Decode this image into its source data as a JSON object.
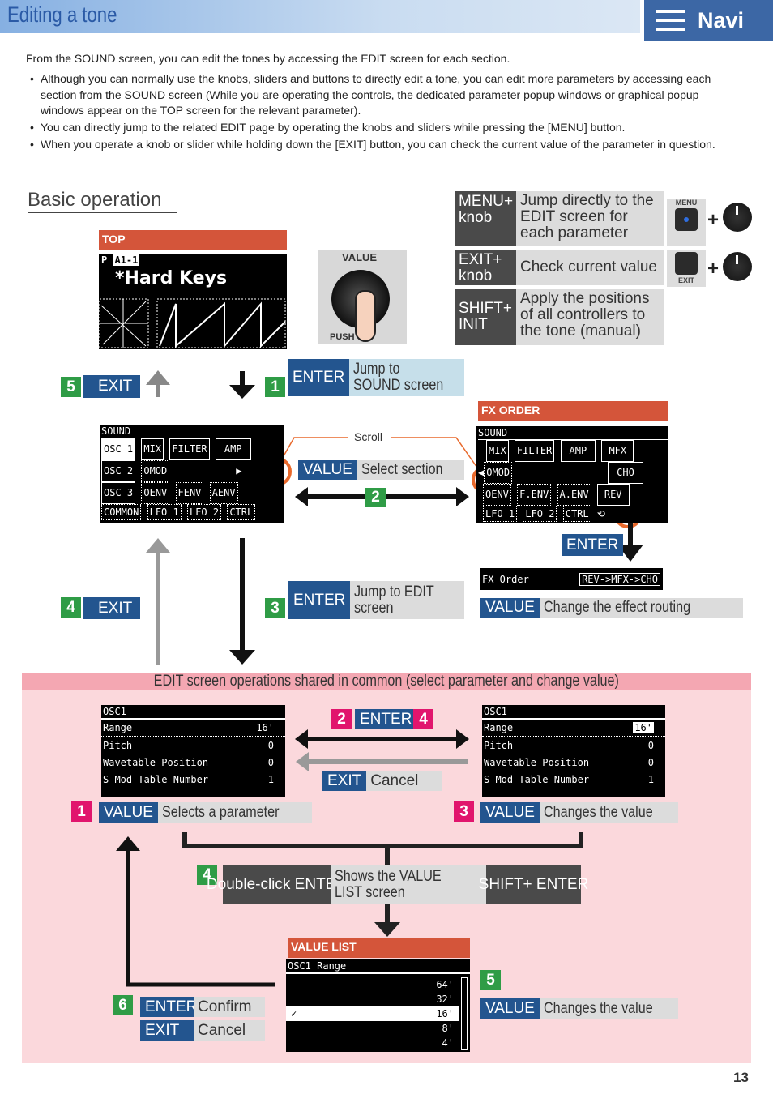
{
  "header": {
    "title": "Editing a tone",
    "navi_label": "Navi",
    "navi_icon": "hamburger-menu-icon"
  },
  "intro": "From the SOUND screen, you can edit the tones by accessing the EDIT screen for each section.",
  "bullets": [
    "Although you can normally use the knobs, sliders and buttons to directly edit a tone, you can edit more parameters by accessing each section from the SOUND screen (While you are operating the controls, the dedicated parameter popup windows or graphical popup windows appear on the TOP screen for the relevant parameter).",
    "You can directly jump to the related EDIT page by operating the knobs and sliders while pressing the [MENU] button.",
    "When you operate a knob or slider while holding down the [EXIT] button, you can check the current value of the parameter in question."
  ],
  "section_title": "Basic operation",
  "shortcuts": [
    {
      "key": "MENU+ knob",
      "desc": "Jump directly to the EDIT screen for each parameter",
      "button": "MENU"
    },
    {
      "key": "EXIT+ knob",
      "desc": "Check current value",
      "button": "EXIT"
    },
    {
      "key": "SHIFT+ INIT",
      "desc": "Apply the positions of all controllers to the tone (manual)"
    }
  ],
  "top_screen": {
    "label": "TOP",
    "bank": "P",
    "patch": "A1-1",
    "name": "*Hard Keys"
  },
  "value_knob": {
    "label": "VALUE",
    "push": "PUSH"
  },
  "flow": {
    "step1": {
      "num": "1",
      "key": "ENTER",
      "desc": "Jump to SOUND screen"
    },
    "step5": {
      "num": "5",
      "key": "EXIT"
    },
    "step2": {
      "num": "2",
      "key": "VALUE",
      "desc": "Select section",
      "scroll": "Scroll"
    },
    "step3": {
      "num": "3",
      "key": "ENTER",
      "desc": "Jump to EDIT screen"
    },
    "step4": {
      "num": "4",
      "key": "EXIT"
    }
  },
  "sound_screen": {
    "title": "SOUND",
    "row1": [
      "OSC 1",
      "MIX",
      "FILTER",
      "AMP"
    ],
    "row2": [
      "OSC 2",
      "OMOD"
    ],
    "row3": [
      "OSC 3",
      "OENV",
      "FENV",
      "AENV"
    ],
    "row4": [
      "COMMON",
      "LFO 1",
      "LFO 2",
      "CTRL"
    ]
  },
  "fx": {
    "label": "FX ORDER",
    "title": "SOUND",
    "row1": [
      "MIX",
      "FILTER",
      "AMP",
      "MFX"
    ],
    "row2": [
      "OMOD",
      "CHO"
    ],
    "row3": [
      "OENV",
      "F.ENV",
      "A.ENV",
      "REV"
    ],
    "row4": [
      "LFO 1",
      "LFO 2",
      "CTRL"
    ],
    "enter": "ENTER",
    "param": "FX Order",
    "value": "REV->MFX->CHO",
    "key": "VALUE",
    "desc": "Change the effect routing"
  },
  "edit": {
    "band": "EDIT screen operations shared in common (select parameter and change value)",
    "screen_title": "OSC1",
    "params": [
      {
        "name": "Range",
        "value": "16'"
      },
      {
        "name": "Pitch",
        "value": "0"
      },
      {
        "name": "Wavetable Position",
        "value": "0"
      },
      {
        "name": "S-Mod Table Number",
        "value": "1"
      }
    ],
    "s2": "2",
    "s4": "4",
    "enter": "ENTER",
    "exit": "EXIT",
    "cancel": "Cancel",
    "s1": {
      "num": "1",
      "key": "VALUE",
      "desc": "Selects a parameter"
    },
    "s3": {
      "num": "3",
      "key": "VALUE",
      "desc": "Changes the value"
    },
    "s4box": {
      "num": "4",
      "left": "Double-click ENTER",
      "mid": "Shows the VALUE LIST screen",
      "right": "SHIFT+ ENTER"
    },
    "valuelist": {
      "label": "VALUE LIST",
      "title": "OSC1 Range",
      "items": [
        "64'",
        "32'",
        "16'",
        "8'",
        "4'"
      ],
      "selected": "16'"
    },
    "s5": {
      "num": "5",
      "key": "VALUE",
      "desc": "Changes the value"
    },
    "s6": {
      "num": "6",
      "enter": "ENTER",
      "confirm": "Confirm",
      "exit": "EXIT",
      "cancel": "Cancel"
    }
  },
  "page_number": "13",
  "colors": {
    "label_blue": "#23558f",
    "green": "#2f9c46",
    "magenta": "#e1156d",
    "orange": "#d4553a",
    "pink": "#fbd8dc"
  }
}
